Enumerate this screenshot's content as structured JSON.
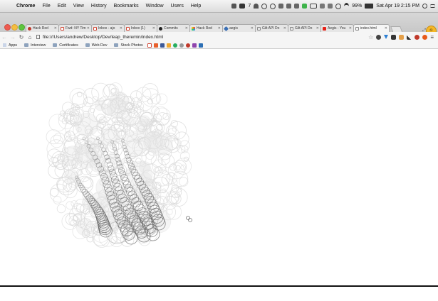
{
  "menubar": {
    "apple_glyph": "",
    "app_name": "Chrome",
    "items": [
      "File",
      "Edit",
      "View",
      "History",
      "Bookmarks",
      "Window",
      "Users",
      "Help"
    ],
    "status": {
      "mail_count": "7",
      "battery": "99%",
      "datetime": "Sat Apr 19  2:15 PM"
    }
  },
  "tabs": [
    {
      "label": "Hack Red"
    },
    {
      "label": "Fwd: NY Tim"
    },
    {
      "label": "Inbox - ajo"
    },
    {
      "label": "Inbox (1)"
    },
    {
      "label": "Commits"
    },
    {
      "label": "Hack Red"
    },
    {
      "label": "aegis"
    },
    {
      "label": "Gilt API Do"
    },
    {
      "label": "Gilt API Do"
    },
    {
      "label": "Aegis - You"
    },
    {
      "label": "index.html"
    }
  ],
  "toolbar": {
    "url": "file:///Users/andrew/Desktop/Dev/leap_theremin/index.html"
  },
  "bookmarks": {
    "apps_label": "Apps",
    "items": [
      "Interview",
      "Certificates",
      "Web Dev",
      "Stock Photos"
    ]
  },
  "colors": {
    "trail_light": "#d6d6d6",
    "trail_dark": "#555555",
    "gmail_red": "#d14836",
    "youtube_red": "#e62117"
  }
}
